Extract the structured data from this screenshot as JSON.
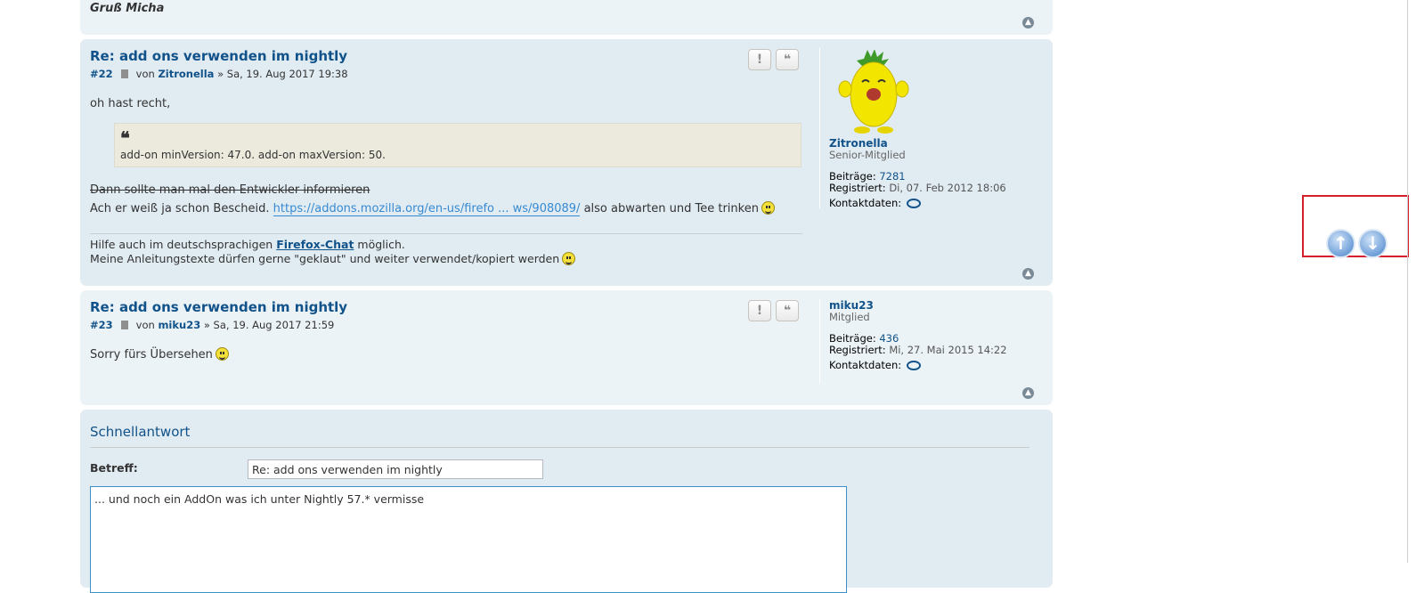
{
  "previous_post": {
    "signature": "Gruß Micha"
  },
  "posts": [
    {
      "title": "Re: add ons verwenden im nightly",
      "number": "#22",
      "by": "von",
      "author": "Zitronella",
      "date": "» Sa, 19. Aug 2017 19:38",
      "body_line1": "oh hast recht,",
      "quote_text": "add-on minVersion: 47.0. add-on maxVersion: 50.",
      "strike_text": "Dann sollte man mal den Entwickler informieren",
      "line_pre": "Ach er weiß ja schon Bescheid.",
      "link_text": "https://addons.mozilla.org/en-us/firefo ... ws/908089/",
      "line_post": "also abwarten und Tee trinken",
      "sig_pre": "Hilfe auch im deutschsprachigen",
      "sig_link": "Firefox-Chat",
      "sig_post": "möglich.",
      "sig_line2": "Meine Anleitungstexte dürfen gerne \"geklaut\" und weiter verwendet/kopiert werden",
      "profile": {
        "name": "Zitronella",
        "rank": "Senior-Mitglied",
        "posts_label": "Beiträge:",
        "posts_value": "7281",
        "registered_label": "Registriert:",
        "registered_value": "Di, 07. Feb 2012 18:06",
        "contact_label": "Kontaktdaten:"
      }
    },
    {
      "title": "Re: add ons verwenden im nightly",
      "number": "#23",
      "by": "von",
      "author": "miku23",
      "date": "» Sa, 19. Aug 2017 21:59",
      "body_line1": "Sorry fürs Übersehen",
      "profile": {
        "name": "miku23",
        "rank": "Mitglied",
        "posts_label": "Beiträge:",
        "posts_value": "436",
        "registered_label": "Registriert:",
        "registered_value": "Mi, 27. Mai 2015 14:22",
        "contact_label": "Kontaktdaten:"
      }
    }
  ],
  "buttons": {
    "report": "!",
    "quote": "❝"
  },
  "quick_reply": {
    "title": "Schnellantwort",
    "subject_label": "Betreff:",
    "subject_value": "Re: add ons verwenden im nightly",
    "message_value": "... und noch ein AddOn was ich unter Nightly 57.* vermisse\n\n"
  },
  "icons": {
    "report": "exclamation-icon",
    "quote": "quote-icon",
    "post": "document-icon",
    "contact": "speech-bubble-icon",
    "back_to_top": "chevron-up-icon",
    "scroll_up": "arrow-up-icon",
    "scroll_down": "arrow-down-icon"
  },
  "colors": {
    "accent": "#105289",
    "link": "#368ad2",
    "post_bg": "#e1ebf2",
    "post_bg_alt": "#ecf3f7",
    "quote_bg": "#ebeadd",
    "highlight": "#d3202c"
  }
}
